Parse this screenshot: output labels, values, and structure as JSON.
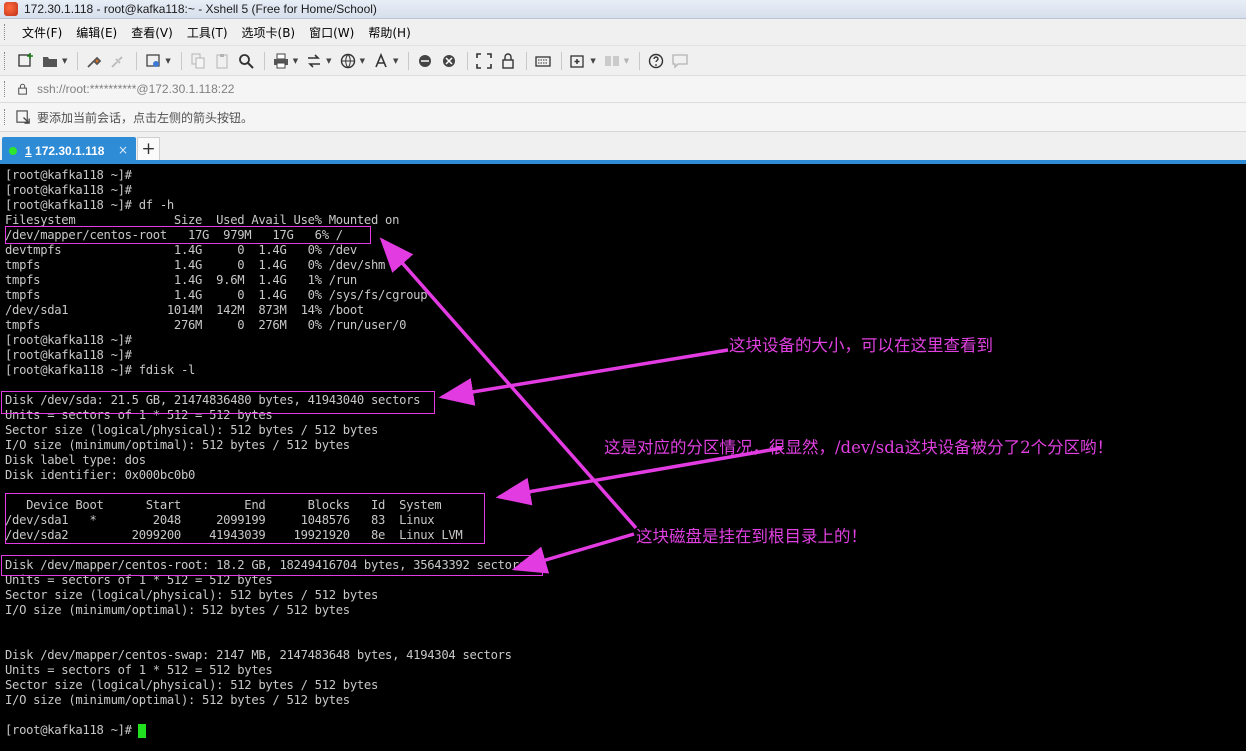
{
  "window": {
    "title": "172.30.1.118 - root@kafka118:~ - Xshell 5 (Free for Home/School)"
  },
  "menu": [
    "文件(F)",
    "编辑(E)",
    "查看(V)",
    "工具(T)",
    "选项卡(B)",
    "窗口(W)",
    "帮助(H)"
  ],
  "toolbar": {
    "icons": [
      "new-session-icon",
      "open-folder-icon",
      "reconnect-icon",
      "disconnect-icon",
      "properties-icon",
      "copy-icon",
      "paste-icon",
      "find-icon",
      "print-icon",
      "transfer-icon",
      "globe-icon",
      "font-icon",
      "xftp-icon",
      "xmanager-icon",
      "fullscreen-icon",
      "lock-icon",
      "keyboard-icon",
      "new-tab-icon",
      "layout-icon",
      "help-icon",
      "chat-icon"
    ]
  },
  "address": {
    "text": "ssh://root:**********@172.30.1.118:22"
  },
  "hint": {
    "text": "要添加当前会话，点击左侧的箭头按钮。"
  },
  "tabs": [
    {
      "number": "1",
      "label": " 172.30.1.118",
      "close": "×",
      "status": "connected"
    }
  ],
  "tab_add_label": "+",
  "terminal": {
    "lines": [
      "[root@kafka118 ~]#",
      "[root@kafka118 ~]#",
      "[root@kafka118 ~]# df -h",
      "Filesystem              Size  Used Avail Use% Mounted on",
      "/dev/mapper/centos-root   17G  979M   17G   6% /",
      "devtmpfs                1.4G     0  1.4G   0% /dev",
      "tmpfs                   1.4G     0  1.4G   0% /dev/shm",
      "tmpfs                   1.4G  9.6M  1.4G   1% /run",
      "tmpfs                   1.4G     0  1.4G   0% /sys/fs/cgroup",
      "/dev/sda1              1014M  142M  873M  14% /boot",
      "tmpfs                   276M     0  276M   0% /run/user/0",
      "[root@kafka118 ~]#",
      "[root@kafka118 ~]#",
      "[root@kafka118 ~]# fdisk -l",
      "",
      "Disk /dev/sda: 21.5 GB, 21474836480 bytes, 41943040 sectors",
      "Units = sectors of 1 * 512 = 512 bytes",
      "Sector size (logical/physical): 512 bytes / 512 bytes",
      "I/O size (minimum/optimal): 512 bytes / 512 bytes",
      "Disk label type: dos",
      "Disk identifier: 0x000bc0b0",
      "",
      "   Device Boot      Start         End      Blocks   Id  System",
      "/dev/sda1   *        2048     2099199     1048576   83  Linux",
      "/dev/sda2         2099200    41943039    19921920   8e  Linux LVM",
      "",
      "Disk /dev/mapper/centos-root: 18.2 GB, 18249416704 bytes, 35643392 sectors",
      "Units = sectors of 1 * 512 = 512 bytes",
      "Sector size (logical/physical): 512 bytes / 512 bytes",
      "I/O size (minimum/optimal): 512 bytes / 512 bytes",
      "",
      "",
      "Disk /dev/mapper/centos-swap: 2147 MB, 2147483648 bytes, 4194304 sectors",
      "Units = sectors of 1 * 512 = 512 bytes",
      "Sector size (logical/physical): 512 bytes / 512 bytes",
      "I/O size (minimum/optimal): 512 bytes / 512 bytes",
      "",
      "[root@kafka118 ~]#"
    ]
  },
  "annotations": {
    "note1": "这块设备的大小，可以在这里查看到",
    "note2": "这是对应的分区情况，很显然，/dev/sda这块设备被分了2个分区哟！",
    "note3": "这块磁盘是挂在到根目录上的！",
    "color": "#e13be1"
  },
  "colors": {
    "tab_active": "#2e8bd6",
    "terminal_bg": "#000000",
    "terminal_fg": "#c8c8c8",
    "cursor": "#20e020",
    "status_dot": "#2ee62e"
  }
}
